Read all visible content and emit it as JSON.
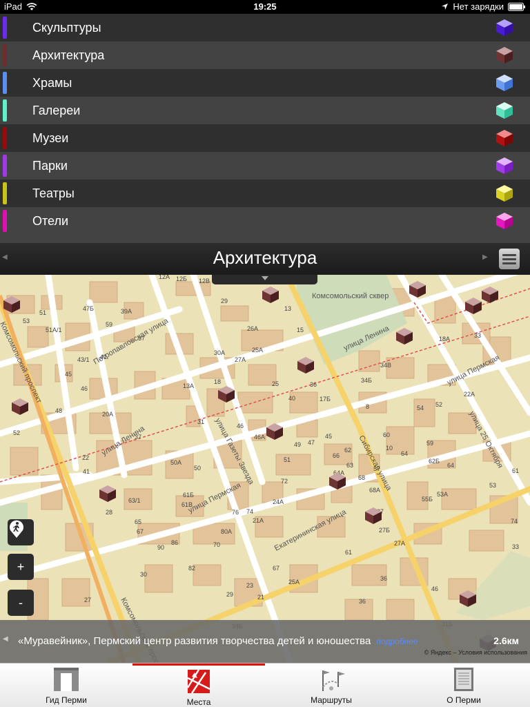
{
  "status_bar": {
    "device": "iPad",
    "time": "19:25",
    "charging": "Нет зарядки"
  },
  "categories": [
    {
      "label": "Скульптуры",
      "color": "#6a2df0"
    },
    {
      "label": "Архитектура",
      "color": "#6e2e2e"
    },
    {
      "label": "Храмы",
      "color": "#5a8ef0"
    },
    {
      "label": "Галереи",
      "color": "#5ff2c8"
    },
    {
      "label": "Музеи",
      "color": "#9b0a0a"
    },
    {
      "label": "Парки",
      "color": "#a03ae6"
    },
    {
      "label": "Театры",
      "color": "#c9c41a"
    },
    {
      "label": "Отели",
      "color": "#e00fb2"
    }
  ],
  "title_bar": {
    "title": "Архитектура"
  },
  "map": {
    "streets": [
      "улица Ленина",
      "Петропавловская улица",
      "Сибирская улица",
      "улица Газеты Звезда",
      "улица Пермская",
      "Екатерининская улица",
      "Комсомольский проспект",
      "улица 25 Октября",
      "Комсомольский сквер",
      "улица Ленина",
      "улица Пермская",
      "Комсомольский проспект"
    ],
    "house_numbers": [
      "12А",
      "12Б",
      "12В",
      "29",
      "51",
      "47Б",
      "39А",
      "59",
      "51А/1",
      "37",
      "43/1",
      "41",
      "45",
      "46",
      "48",
      "20А",
      "37",
      "52",
      "22",
      "41",
      "30А",
      "26А",
      "27А",
      "25А",
      "15",
      "13",
      "13А",
      "18",
      "25",
      "40",
      "17Б",
      "36",
      "31",
      "46",
      "46А",
      "49",
      "47",
      "45",
      "51",
      "50А",
      "50",
      "63/1",
      "61Б",
      "61В",
      "65",
      "67",
      "28",
      "76",
      "74",
      "86",
      "90",
      "82",
      "80А",
      "70",
      "21А",
      "72",
      "24А",
      "66",
      "62",
      "63",
      "64А",
      "68А",
      "68",
      "57",
      "60",
      "64",
      "59",
      "62Б",
      "55Б",
      "53А",
      "53",
      "61",
      "67",
      "25А",
      "36",
      "46",
      "31Б",
      "16",
      "18А",
      "33",
      "34В",
      "34Б",
      "8",
      "22А",
      "10",
      "52",
      "54",
      "64",
      "61",
      "27",
      "27А",
      "36",
      "27Б",
      "74",
      "33",
      "30",
      "27",
      "34Б",
      "29",
      "23",
      "21"
    ],
    "controls": {
      "zoom_in": "+",
      "zoom_out": "-"
    }
  },
  "info_bar": {
    "place": "«Муравейник», Пермский центр развития творчества детей и юношества",
    "more_link": "подробнее",
    "distance": "2.6км",
    "copyright": "© Яндекс – Условия использования"
  },
  "tabbar": [
    {
      "label": "Гид Перми",
      "icon": "gate-icon"
    },
    {
      "label": "Места",
      "icon": "map-places-icon"
    },
    {
      "label": "Маршруты",
      "icon": "route-flags-icon"
    },
    {
      "label": "О Перми",
      "icon": "book-icon"
    }
  ]
}
